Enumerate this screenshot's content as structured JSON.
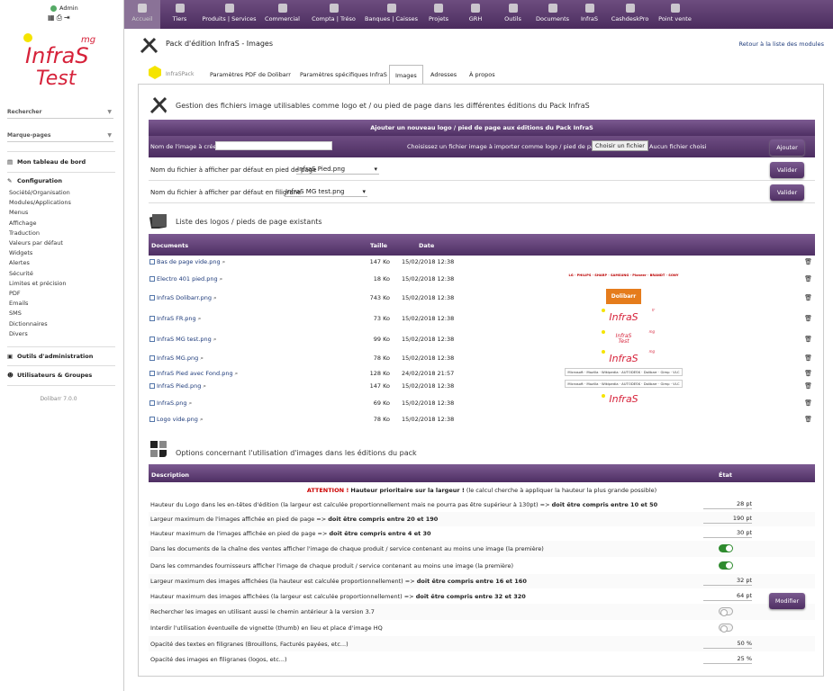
{
  "user": {
    "name": "Admin"
  },
  "brand": {
    "small": "mg",
    "line1": "InfraS",
    "line2": "Test"
  },
  "sidebar": {
    "search_label": "Rechercher",
    "bookmarks_label": "Marque-pages",
    "dashboard": "Mon tableau de bord",
    "config_title": "Configuration",
    "config_items": [
      "Société/Organisation",
      "Modules/Applications",
      "Menus",
      "Affichage",
      "Traduction",
      "Valeurs par défaut",
      "Widgets",
      "Alertes",
      "Sécurité",
      "Limites et précision",
      "PDF",
      "Emails",
      "SMS",
      "Dictionnaires",
      "Divers"
    ],
    "admin_tools": "Outils d'administration",
    "users_groups": "Utilisateurs & Groupes",
    "version": "Dolibarr 7.0.0"
  },
  "topnav": [
    "Accueil",
    "Tiers",
    "Produits | Services",
    "Commercial",
    "Compta | Tréso",
    "Banques | Caisses",
    "Projets",
    "GRH",
    "Outils",
    "Documents",
    "InfraS",
    "CashdeskPro",
    "Point vente"
  ],
  "page": {
    "title": "Pack d'édition InfraS - Images",
    "back_link": "Retour à la liste des modules"
  },
  "tabs": [
    "InfraSPack",
    "Paramètres PDF de Dolibarr",
    "Paramètres spécifiques InfraS",
    "Images",
    "Adresses",
    "À propos"
  ],
  "images": {
    "section_title": "Gestion des fichiers image utilisables comme logo et / ou pied de page dans les différentes éditions du Pack InfraS",
    "add_header": "Ajouter un nouveau logo / pied de page aux éditions du Pack InfraS",
    "name_label": "Nom de l'image à créer",
    "choose_label": "Choisissez un fichier image à importer comme logo / pied de page",
    "choose_button": "Choisir un fichier",
    "no_file": "Aucun fichier choisi",
    "add_button": "Ajouter",
    "footer_label": "Nom du fichier à afficher par défaut en pied de page",
    "footer_value": "InfraS Pied.png",
    "watermark_label": "Nom du fichier à afficher par défaut en filigrane",
    "watermark_value": "InfraS MG test.png",
    "validate_button": "Valider"
  },
  "list": {
    "section_title": "Liste des logos / pieds de page existants",
    "headers": [
      "Documents",
      "Taille",
      "Date"
    ],
    "rows": [
      {
        "name": "Bas de page vide.png",
        "size": "147 Ko",
        "date": "15/02/2018 12:38",
        "preview": ""
      },
      {
        "name": "Electro 401 pied.png",
        "size": "18 Ko",
        "date": "15/02/2018 12:38",
        "preview": "electro"
      },
      {
        "name": "InfraS Dolibarr.png",
        "size": "743 Ko",
        "date": "15/02/2018 12:38",
        "preview": "dolibarr"
      },
      {
        "name": "InfraS FR.png",
        "size": "73 Ko",
        "date": "15/02/2018 12:38",
        "preview": "infras-fr"
      },
      {
        "name": "InfraS MG test.png",
        "size": "99 Ko",
        "date": "15/02/2018 12:38",
        "preview": "infras-mg-test"
      },
      {
        "name": "InfraS MG.png",
        "size": "78 Ko",
        "date": "15/02/2018 12:38",
        "preview": "infras-mg"
      },
      {
        "name": "InfraS Pied avec Fond.png",
        "size": "128 Ko",
        "date": "24/02/2018 21:57",
        "preview": "pied"
      },
      {
        "name": "InfraS Pied.png",
        "size": "147 Ko",
        "date": "15/02/2018 12:38",
        "preview": "pied"
      },
      {
        "name": "InfraS.png",
        "size": "69 Ko",
        "date": "15/02/2018 12:38",
        "preview": "infras"
      },
      {
        "name": "Logo vide.png",
        "size": "78 Ko",
        "date": "15/02/2018 12:38",
        "preview": ""
      }
    ]
  },
  "options": {
    "section_title": "Options concernant l'utilisation d'images dans les éditions du pack",
    "headers": [
      "Description",
      "État"
    ],
    "attention_prefix": "ATTENTION !",
    "attention_bold": "Hauteur prioritaire sur la largeur !",
    "attention_rest": "(le calcul cherche à appliquer la hauteur la plus grande possible)",
    "rows": [
      {
        "text": "Hauteur du Logo dans les en-têtes d'édition (la largeur est calculée proportionnellement mais ne pourra pas être supérieur à 130pt) => ",
        "bold": "doit être compris entre 10 et 50",
        "value": "28 pt",
        "type": "value"
      },
      {
        "text": "Largeur maximum de l'images affichée en pied de page => ",
        "bold": "doit être compris entre 20 et 190",
        "value": "190 pt",
        "type": "value"
      },
      {
        "text": "Hauteur maximum de l'images affichée en pied de page => ",
        "bold": "doit être compris entre 4 et 30",
        "value": "30 pt",
        "type": "value"
      },
      {
        "text": "Dans les documents de la chaîne des ventes afficher l'image de chaque produit / service contenant au moins une image (la première)",
        "bold": "",
        "value": "on",
        "type": "toggle"
      },
      {
        "text": "Dans les commandes fournisseurs afficher l'image de chaque produit / service contenant au moins une image (la première)",
        "bold": "",
        "value": "on",
        "type": "toggle"
      },
      {
        "text": "Largeur maximum des images affichées (la hauteur est calculée proportionnellement) => ",
        "bold": "doit être compris entre 16 et 160",
        "value": "32 pt",
        "type": "value"
      },
      {
        "text": "Hauteur maximum des images affichées (la largeur est calculée proportionnellement) => ",
        "bold": "doit être compris entre 32 et 320",
        "value": "64 pt",
        "type": "value"
      },
      {
        "text": "Rechercher les images en utilisant aussi le chemin antérieur à la version 3.7",
        "bold": "",
        "value": "off",
        "type": "toggle"
      },
      {
        "text": "Interdir l'utilisation éventuelle de vignette (thumb) en lieu et place d'image HQ",
        "bold": "",
        "value": "off",
        "type": "toggle"
      },
      {
        "text": "Opacité des textes en filigranes (Brouillons, Facturés payées, etc...)",
        "bold": "",
        "value": "50 %",
        "type": "value"
      },
      {
        "text": "Opacité des images en filigranes (logos, etc...)",
        "bold": "",
        "value": "25 %",
        "type": "value"
      }
    ],
    "modify_button": "Modifier"
  },
  "preview_text": {
    "infras": "InfraS",
    "fr": "fr",
    "mg": "mg",
    "test": "Test",
    "electro": "LG · PHILIPS · SHARP · SAMSUNG · Pioneer · BRANDT · SONY",
    "dolibarr": "Dolibarr",
    "pied": "Microsoft · Mozilla · Wikipedia · AUTODESK · Dolibarr · Gimp · VLC"
  },
  "colors": {
    "purple": "#5b3a70",
    "brand_red": "#d6223a",
    "brand_yellow": "#f5e400",
    "toggle_on": "#2e8b2e"
  }
}
